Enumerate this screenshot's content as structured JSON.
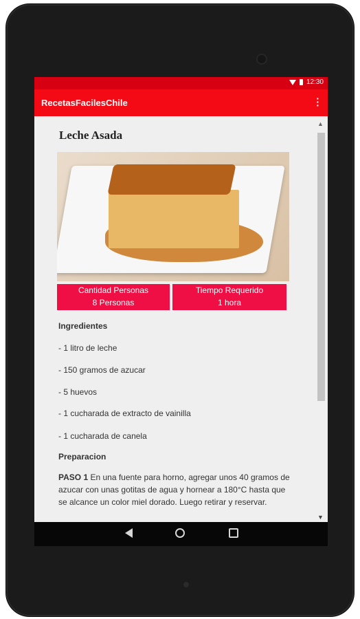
{
  "status_bar": {
    "time": "12:30"
  },
  "app_bar": {
    "title": "RecetasFacilesChile"
  },
  "recipe": {
    "title": "Leche Asada",
    "info": {
      "servings_label": "Cantidad Personas",
      "servings_value": "8 Personas",
      "time_label": "Tiempo Requerido",
      "time_value": "1 hora"
    },
    "ingredients_heading": "Ingredientes",
    "ingredients": [
      "- 1 litro de leche",
      "- 150 gramos de azucar",
      "- 5 huevos",
      "- 1 cucharada de extracto de vainilla",
      "- 1 cucharada de canela"
    ],
    "preparation_heading": "Preparacion",
    "steps": [
      {
        "label": "PASO 1",
        "text": " En una fuente para horno, agregar unos 40 gramos de azucar con unas gotitas de agua y hornear a 180°C hasta que se alcance un color miel dorado. Luego retirar y reservar."
      }
    ]
  },
  "icons": {
    "status": [
      "wifi-icon",
      "battery-icon"
    ],
    "app_bar": [
      "overflow-menu-icon"
    ],
    "nav": [
      "back-icon",
      "home-icon",
      "recent-apps-icon"
    ],
    "scroll": [
      "scroll-up-icon",
      "scroll-down-icon"
    ]
  },
  "colors": {
    "status_bar": "#d60012",
    "app_bar": "#f40a15",
    "info_box": "#f00f45",
    "background": "#efefef"
  }
}
